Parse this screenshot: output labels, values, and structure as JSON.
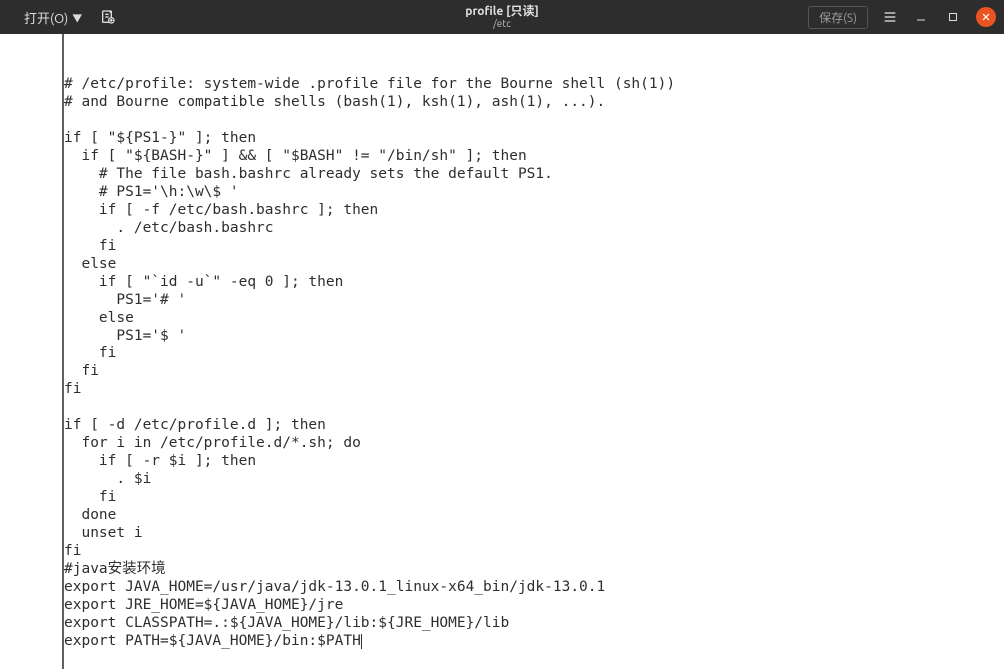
{
  "titlebar": {
    "open_label": "打开(O)",
    "title_main": "profile [只读]",
    "title_sub": "/etc",
    "save_label": "保存(S)"
  },
  "editor": {
    "lines": [
      "# /etc/profile: system-wide .profile file for the Bourne shell (sh(1))",
      "# and Bourne compatible shells (bash(1), ksh(1), ash(1), ...).",
      "",
      "if [ \"${PS1-}\" ]; then",
      "  if [ \"${BASH-}\" ] && [ \"$BASH\" != \"/bin/sh\" ]; then",
      "    # The file bash.bashrc already sets the default PS1.",
      "    # PS1='\\h:\\w\\$ '",
      "    if [ -f /etc/bash.bashrc ]; then",
      "      . /etc/bash.bashrc",
      "    fi",
      "  else",
      "    if [ \"`id -u`\" -eq 0 ]; then",
      "      PS1='# '",
      "    else",
      "      PS1='$ '",
      "    fi",
      "  fi",
      "fi",
      "",
      "if [ -d /etc/profile.d ]; then",
      "  for i in /etc/profile.d/*.sh; do",
      "    if [ -r $i ]; then",
      "      . $i",
      "    fi",
      "  done",
      "  unset i",
      "fi",
      "#java安装环境",
      "export JAVA_HOME=/usr/java/jdk-13.0.1_linux-x64_bin/jdk-13.0.1",
      "export JRE_HOME=${JAVA_HOME}/jre",
      "export CLASSPATH=.:${JAVA_HOME}/lib:${JRE_HOME}/lib",
      "export PATH=${JAVA_HOME}/bin:$PATH"
    ]
  }
}
